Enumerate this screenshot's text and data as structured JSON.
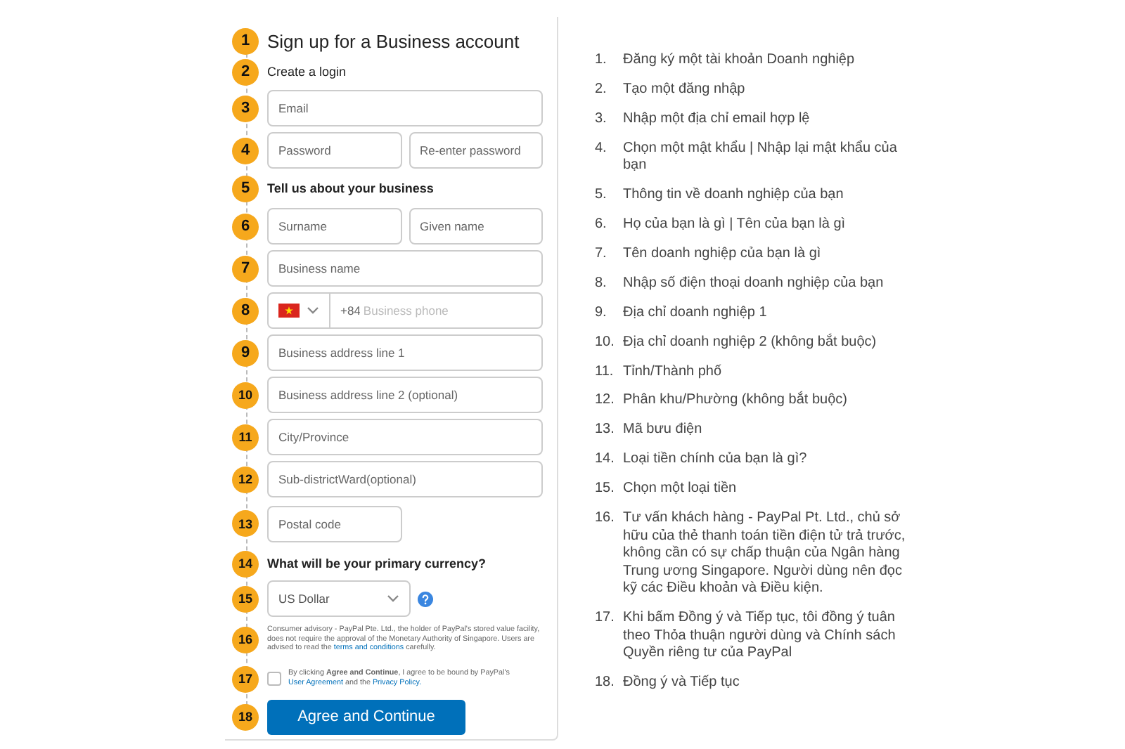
{
  "form": {
    "steps": [
      {
        "number": "1",
        "kind": "title",
        "text": "Sign up for a Business account"
      },
      {
        "number": "2",
        "kind": "label",
        "text": "Create a login"
      },
      {
        "number": "3",
        "kind": "fields",
        "fields": [
          {
            "placeholder": "Email"
          }
        ]
      },
      {
        "number": "4",
        "kind": "fields",
        "fields": [
          {
            "placeholder": "Password"
          },
          {
            "placeholder": "Re-enter password"
          }
        ]
      },
      {
        "number": "5",
        "kind": "label",
        "text": "Tell us about your business"
      },
      {
        "number": "6",
        "kind": "fields",
        "fields": [
          {
            "placeholder": "Surname"
          },
          {
            "placeholder": "Given name"
          }
        ]
      },
      {
        "number": "7",
        "kind": "fields",
        "fields": [
          {
            "placeholder": "Business name"
          }
        ]
      },
      {
        "number": "8",
        "kind": "phone",
        "code": "+84",
        "placeholder": "Business phone"
      },
      {
        "number": "9",
        "kind": "fields",
        "fields": [
          {
            "placeholder": "Business address line 1"
          }
        ]
      },
      {
        "number": "10",
        "kind": "fields",
        "fields": [
          {
            "placeholder": "Business address line 2 (optional)"
          }
        ]
      },
      {
        "number": "11",
        "kind": "fields",
        "fields": [
          {
            "placeholder": "City/Province"
          }
        ]
      },
      {
        "number": "12",
        "kind": "fields",
        "fields": [
          {
            "placeholder": "Sub-districtWard(optional)"
          }
        ]
      },
      {
        "number": "13",
        "kind": "short_field",
        "placeholder": "Postal code"
      },
      {
        "number": "14",
        "kind": "label",
        "text": "What will be your primary currency?"
      },
      {
        "number": "15",
        "kind": "select",
        "value": "US Dollar"
      },
      {
        "number": "16",
        "kind": "advisory",
        "text": "Consumer advisory - PayPal Pte. Ltd., the holder of PayPal's stored value facility, does not require the approval of the Monetary Authority of Singapore. Users are advised to read the",
        "link": "terms and conditions",
        "after": "carefully."
      },
      {
        "number": "17",
        "kind": "consent",
        "checked": false,
        "text": "By clicking **Agree and Continue**, I agree to be bound by PayPal's",
        "link1": "User Agreement",
        "middle": "and the",
        "link2": "Privacy Policy."
      },
      {
        "number": "18",
        "kind": "button",
        "text": "Agree and Continue"
      }
    ]
  },
  "notes": [
    {
      "number": "1.",
      "text": "Đăng ký một tài khoản Doanh nghiệp"
    },
    {
      "number": "2.",
      "text": "Tạo một đăng nhập"
    },
    {
      "number": "3.",
      "text": "Nhập một địa chỉ email hợp lệ"
    },
    {
      "number": "4.",
      "text": "Chọn một mật khẩu | Nhập lại mật khẩu của bạn"
    },
    {
      "number": "5.",
      "text": "Thông tin về doanh nghiệp của bạn"
    },
    {
      "number": "6.",
      "text": "Họ của bạn là gì | Tên của bạn là gì"
    },
    {
      "number": "7.",
      "text": "Tên doanh nghiệp của bạn là gì"
    },
    {
      "number": "8.",
      "text": "Nhập số điện thoại doanh nghiệp của bạn"
    },
    {
      "number": "9.",
      "text": "Địa chỉ doanh nghiệp 1"
    },
    {
      "number": "10.",
      "text": "Địa chỉ doanh nghiệp 2 (không bắt buộc)"
    },
    {
      "number": "11.",
      "text": "Tỉnh/Thành phố"
    },
    {
      "number": "12.",
      "text": "Phân khu/Phường (không bắt buộc)"
    },
    {
      "number": "13.",
      "text": "Mã bưu điện"
    },
    {
      "number": "14.",
      "text": "Loại tiền chính của bạn là gì?"
    },
    {
      "number": "15.",
      "text": "Chọn một loại tiền"
    },
    {
      "number": "16.",
      "text": "Tư vấn khách hàng - PayPal Pt. Ltd., chủ sở hữu của thẻ thanh toán tiền điện tử trả trước, không cần có sự chấp thuận của Ngân hàng Trung ương Singapore. Người dùng nên đọc kỹ các Điều khoản và Điều kiện."
    },
    {
      "number": "17.",
      "text": "Khi bấm Đồng ý và Tiếp tục, tôi đồng ý tuân theo Thỏa thuận người dùng và Chính sách Quyền riêng tư của PayPal"
    },
    {
      "number": "18.",
      "text": "Đồng ý và Tiếp tục"
    }
  ]
}
